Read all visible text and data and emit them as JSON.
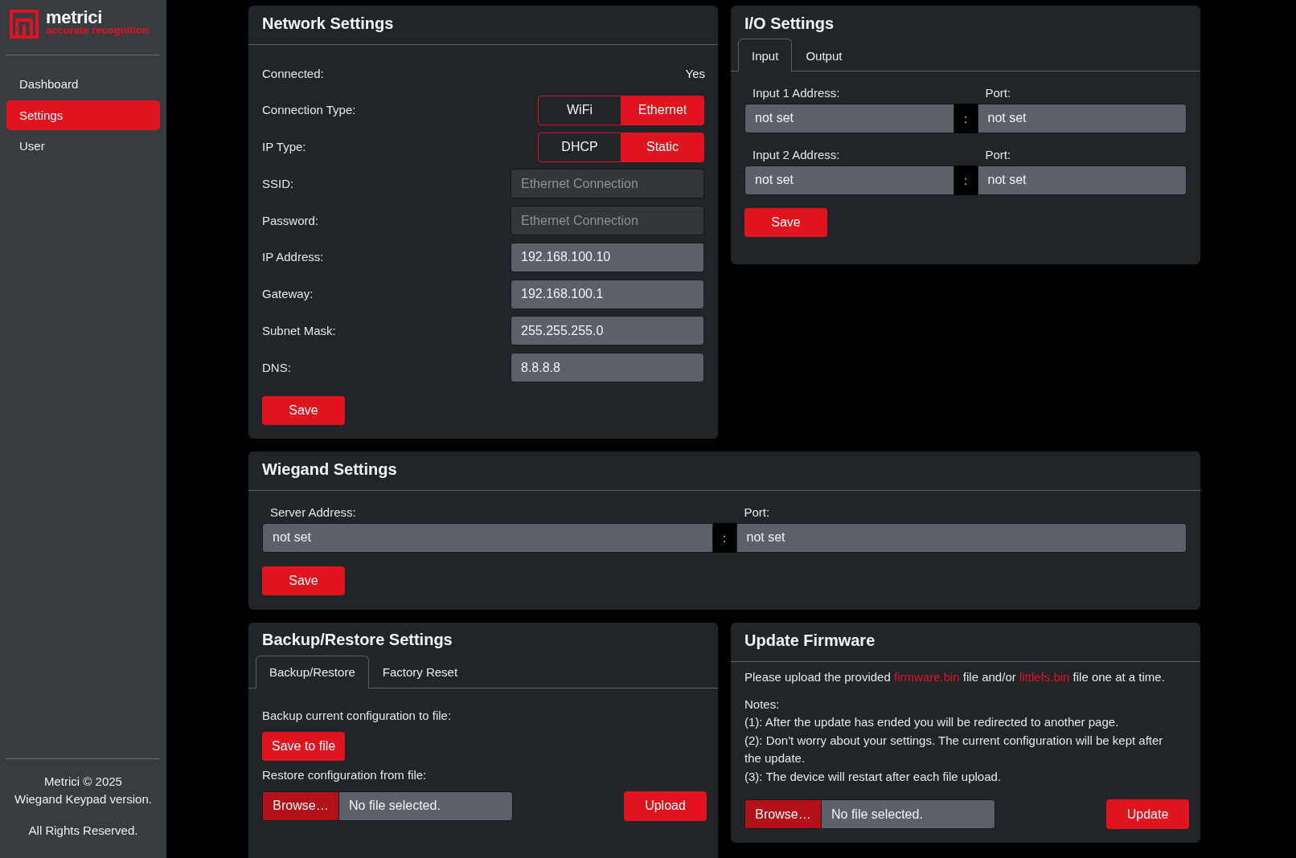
{
  "sidebar": {
    "logo": {
      "name": "metrici",
      "tagline": "accurate recognition"
    },
    "items": [
      {
        "label": "Dashboard",
        "selected": false
      },
      {
        "label": "Settings",
        "selected": true
      },
      {
        "label": "User",
        "selected": false
      }
    ],
    "footer": {
      "lines": [
        "Metrici © 2025",
        "Wiegand Keypad version."
      ],
      "rights": "All Rights Reserved."
    }
  },
  "network_settings": {
    "title": "Network Settings",
    "rows": [
      {
        "kind": "status",
        "label": "Connected:",
        "value": "Yes"
      },
      {
        "kind": "toggle",
        "label": "Connection Type:",
        "options": [
          {
            "label": "WiFi",
            "selected": false
          },
          {
            "label": "Ethernet",
            "selected": true
          }
        ]
      },
      {
        "kind": "toggle",
        "label": "IP Type:",
        "options": [
          {
            "label": "DHCP",
            "selected": false
          },
          {
            "label": "Static",
            "selected": true
          }
        ]
      },
      {
        "kind": "field",
        "label": "SSID:",
        "placeholder": "Ethernet Connection",
        "disabled": true
      },
      {
        "kind": "field",
        "label": "Password:",
        "placeholder": "Ethernet Connection",
        "disabled": true
      },
      {
        "kind": "field",
        "label": "IP Address:",
        "value": "192.168.100.10",
        "disabled": false
      },
      {
        "kind": "field",
        "label": "Gateway:",
        "value": "192.168.100.1",
        "disabled": false
      },
      {
        "kind": "field",
        "label": "Subnet Mask:",
        "value": "255.255.255.0",
        "disabled": false
      },
      {
        "kind": "field",
        "label": "DNS:",
        "value": "8.8.8.8",
        "disabled": false
      }
    ],
    "save_button": "Save"
  },
  "io_settings": {
    "title": "I/O Settings",
    "tabs": [
      {
        "label": "Input",
        "selected": true
      },
      {
        "label": "Output",
        "selected": false
      }
    ],
    "inputs": [
      {
        "address_label": "Input 1 Address:",
        "address": "not set",
        "separator": ":",
        "port_label": "Port:",
        "port": "not set"
      },
      {
        "address_label": "Input 2 Address:",
        "address": "not set",
        "separator": ":",
        "port_label": "Port:",
        "port": "not set"
      }
    ],
    "save_button": "Save"
  },
  "wiegand_settings": {
    "title": "Wiegand Settings",
    "server": {
      "address_label": "Server Address:",
      "address": "not set",
      "separator": ":",
      "port_label": "Port:",
      "port": "not set"
    },
    "save_button": "Save"
  },
  "backup_restore": {
    "title": "Backup/Restore Settings",
    "tabs": [
      {
        "label": "Backup/Restore",
        "selected": true
      },
      {
        "label": "Factory Reset",
        "selected": false
      }
    ],
    "backup_label": "Backup current configuration to file:",
    "save_to_file_button": "Save to file",
    "restore_label": "Restore configuration from file:",
    "file_input": {
      "browse_button": "Browse…",
      "status": "No file selected."
    },
    "upload_button": "Upload"
  },
  "update_firmware": {
    "title": "Update Firmware",
    "intro": [
      {
        "kind": "text",
        "text": "Please upload the provided "
      },
      {
        "kind": "link",
        "text": "firmware.bin"
      },
      {
        "kind": "text",
        "text": " file and/or "
      },
      {
        "kind": "link",
        "text": "littlefs.bin"
      },
      {
        "kind": "text",
        "text": " file one at a time."
      }
    ],
    "notes": {
      "heading": "Notes:",
      "items": [
        "(1): After the update has ended you will be redirected to another page.",
        "(2): Don't worry about your settings. The current configuration will be kept after the update.",
        "(3): The device will restart after each file upload."
      ]
    },
    "file_input": {
      "browse_button": "Browse…",
      "status": "No file selected."
    },
    "update_button": "Update"
  }
}
